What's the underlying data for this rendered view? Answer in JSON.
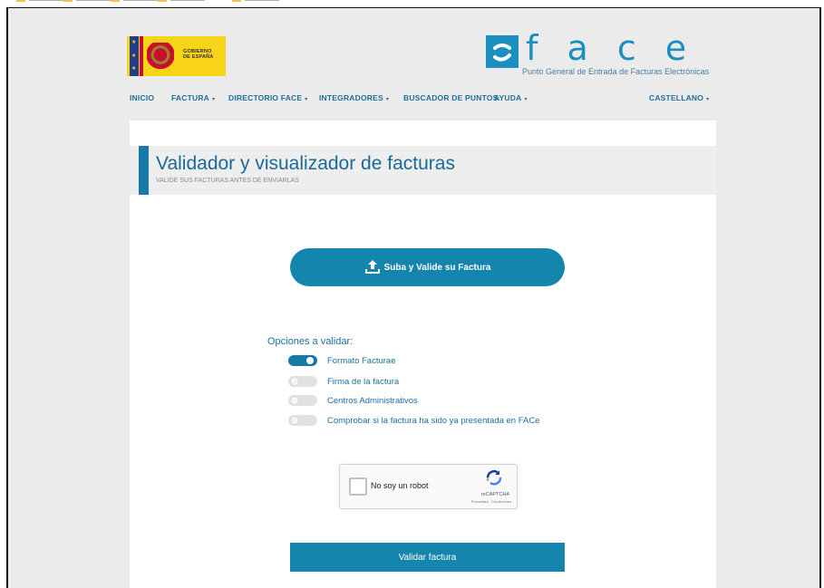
{
  "header": {
    "gobierno_line1": "GOBIERNO",
    "gobierno_line2": "DE ESPAÑA",
    "face_letters": "f a c e",
    "face_tagline": "Punto General de Entrada de Facturas Electrónicas"
  },
  "nav": {
    "items": [
      {
        "label": "INICIO",
        "has_dropdown": false
      },
      {
        "label": "FACTURA",
        "has_dropdown": true
      },
      {
        "label": "DIRECTORIO FACE",
        "has_dropdown": true
      },
      {
        "label": "INTEGRADORES",
        "has_dropdown": true
      },
      {
        "label": "BUSCADOR DE PUNTOS",
        "has_dropdown": false
      },
      {
        "label": "AYUDA",
        "has_dropdown": true
      }
    ],
    "language": "CASTELLANO",
    "caret": "▾"
  },
  "page": {
    "title": "Validador y visualizador de facturas",
    "subtitle": "VALIDE SUS FACTURAS ANTES DE ENVIARLAS"
  },
  "upload": {
    "label": "Suba y Valide su Factura",
    "icon": "upload-icon"
  },
  "options": {
    "heading": "Opciones a validar:",
    "items": [
      {
        "label": "Formato Facturae",
        "enabled": true
      },
      {
        "label": "Firma de la factura",
        "enabled": false
      },
      {
        "label": "Centros Administrativos",
        "enabled": false
      },
      {
        "label": "Comprobar si la factura ha sido ya presentada en FACe",
        "enabled": false
      }
    ]
  },
  "recaptcha": {
    "label": "No soy un robot",
    "brand": "reCAPTCHA",
    "terms": "Privacidad - Condiciones"
  },
  "validate": {
    "label": "Validar factura"
  },
  "colors": {
    "primary": "#1485ac",
    "link": "#1e6f9a",
    "background": "#ebebeb",
    "gob_yellow": "#f7d417"
  }
}
